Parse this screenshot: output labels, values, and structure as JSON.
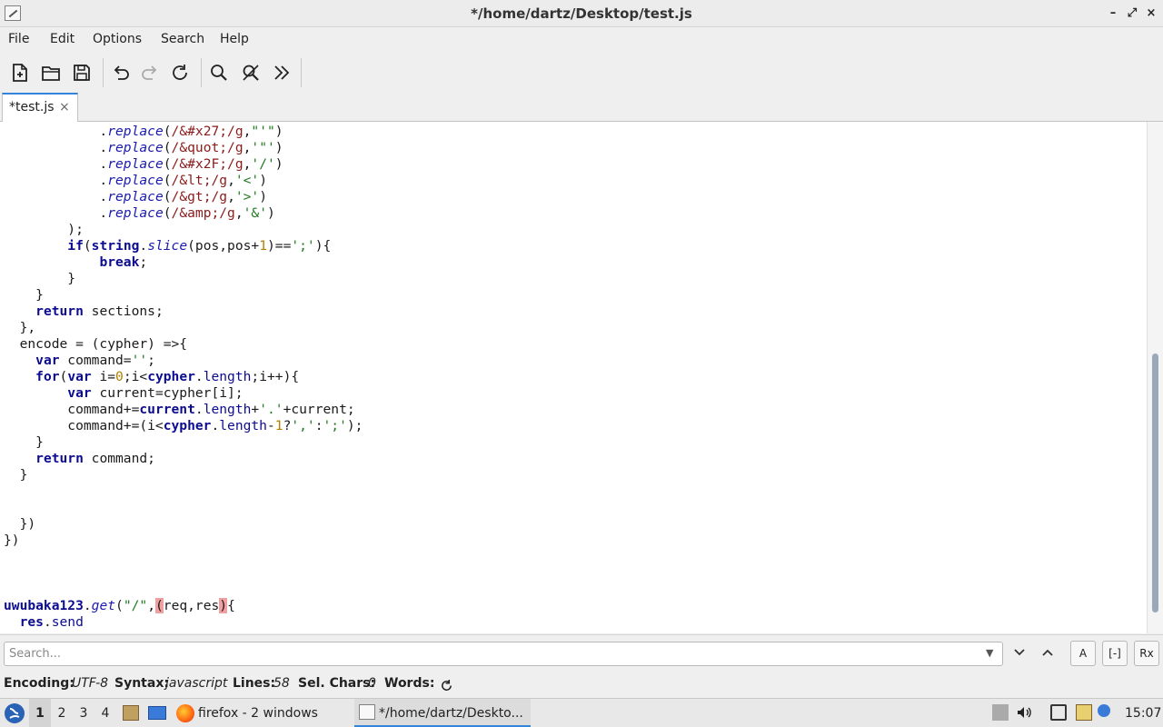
{
  "window": {
    "title": "*/home/dartz/Desktop/test.js"
  },
  "menu": [
    "File",
    "Edit",
    "Options",
    "Search",
    "Help"
  ],
  "tab": {
    "label": "*test.js",
    "close": "×"
  },
  "code_lines": [
    [
      [
        "            .",
        ""
      ],
      [
        "replace",
        "ki"
      ],
      [
        "(",
        ""
      ],
      [
        "/&#x27;/g",
        "rx"
      ],
      [
        ",",
        ""
      ],
      [
        "\"'\"",
        "st"
      ],
      [
        ")",
        ""
      ]
    ],
    [
      [
        "            .",
        ""
      ],
      [
        "replace",
        "ki"
      ],
      [
        "(",
        ""
      ],
      [
        "/&quot;/g",
        "rx"
      ],
      [
        ",",
        ""
      ],
      [
        "'\"'",
        "st"
      ],
      [
        ")",
        ""
      ]
    ],
    [
      [
        "            .",
        ""
      ],
      [
        "replace",
        "ki"
      ],
      [
        "(",
        ""
      ],
      [
        "/&#x2F;/g",
        "rx"
      ],
      [
        ",",
        ""
      ],
      [
        "'/'",
        "st"
      ],
      [
        ")",
        ""
      ]
    ],
    [
      [
        "            .",
        ""
      ],
      [
        "replace",
        "ki"
      ],
      [
        "(",
        ""
      ],
      [
        "/&lt;/g",
        "rx"
      ],
      [
        ",",
        ""
      ],
      [
        "'<'",
        "st"
      ],
      [
        ")",
        ""
      ]
    ],
    [
      [
        "            .",
        ""
      ],
      [
        "replace",
        "ki"
      ],
      [
        "(",
        ""
      ],
      [
        "/&gt;/g",
        "rx"
      ],
      [
        ",",
        ""
      ],
      [
        "'>'",
        "st"
      ],
      [
        ")",
        ""
      ]
    ],
    [
      [
        "            .",
        ""
      ],
      [
        "replace",
        "ki"
      ],
      [
        "(",
        ""
      ],
      [
        "/&amp;/g",
        "rx"
      ],
      [
        ",",
        ""
      ],
      [
        "'&'",
        "st"
      ],
      [
        ")",
        ""
      ]
    ],
    [
      [
        "        );",
        ""
      ]
    ],
    [
      [
        "        ",
        ""
      ],
      [
        "if",
        "kw"
      ],
      [
        "(",
        ""
      ],
      [
        "string",
        "kw"
      ],
      [
        ".",
        ""
      ],
      [
        "slice",
        "ki"
      ],
      [
        "(pos,pos+",
        ""
      ],
      [
        "1",
        "num"
      ],
      [
        ")==",
        ""
      ],
      [
        "';'",
        "st"
      ],
      [
        "){",
        ""
      ]
    ],
    [
      [
        "            ",
        ""
      ],
      [
        "break",
        "kw"
      ],
      [
        ";",
        ""
      ]
    ],
    [
      [
        "        }",
        ""
      ]
    ],
    [
      [
        "    }",
        ""
      ]
    ],
    [
      [
        "    ",
        ""
      ],
      [
        "return",
        "kw"
      ],
      [
        " sections;",
        ""
      ]
    ],
    [
      [
        "  },",
        ""
      ]
    ],
    [
      [
        "  encode = (cypher) =>{",
        ""
      ]
    ],
    [
      [
        "    ",
        ""
      ],
      [
        "var",
        "kw"
      ],
      [
        " command=",
        ""
      ],
      [
        "''",
        "st"
      ],
      [
        ";",
        ""
      ]
    ],
    [
      [
        "    ",
        ""
      ],
      [
        "for",
        "kw"
      ],
      [
        "(",
        ""
      ],
      [
        "var",
        "kw"
      ],
      [
        " i=",
        ""
      ],
      [
        "0",
        "num"
      ],
      [
        ";i<",
        ""
      ],
      [
        "cypher",
        "kw"
      ],
      [
        ".",
        ""
      ],
      [
        "length",
        "kn"
      ],
      [
        ";i++){",
        ""
      ]
    ],
    [
      [
        "        ",
        ""
      ],
      [
        "var",
        "kw"
      ],
      [
        " current=cypher[i];",
        ""
      ]
    ],
    [
      [
        "        command+=",
        ""
      ],
      [
        "current",
        "kw"
      ],
      [
        ".",
        ""
      ],
      [
        "length",
        "kn"
      ],
      [
        "+",
        ""
      ],
      [
        "'.'",
        "st"
      ],
      [
        "+current;",
        ""
      ]
    ],
    [
      [
        "        command+=(i<",
        ""
      ],
      [
        "cypher",
        "kw"
      ],
      [
        ".",
        ""
      ],
      [
        "length",
        "kn"
      ],
      [
        "-",
        ""
      ],
      [
        "1",
        "num"
      ],
      [
        "?",
        ""
      ],
      [
        "','",
        "st"
      ],
      [
        ":",
        ""
      ],
      [
        "';'",
        "st"
      ],
      [
        ");",
        ""
      ]
    ],
    [
      [
        "    }",
        ""
      ]
    ],
    [
      [
        "    ",
        ""
      ],
      [
        "return",
        "kw"
      ],
      [
        " command;",
        ""
      ]
    ],
    [
      [
        "  }",
        ""
      ]
    ],
    [
      [
        "",
        ""
      ]
    ],
    [
      [
        "",
        ""
      ]
    ],
    [
      [
        "  })",
        ""
      ]
    ],
    [
      [
        "})",
        ""
      ]
    ],
    [
      [
        "",
        ""
      ]
    ],
    [
      [
        "",
        ""
      ]
    ],
    [
      [
        "",
        ""
      ]
    ],
    [
      [
        "uwubaka123",
        "kw"
      ],
      [
        ".",
        ""
      ],
      [
        "get",
        "ki"
      ],
      [
        "(",
        ""
      ],
      [
        "\"/\"",
        "st"
      ],
      [
        ",",
        ""
      ],
      [
        "(",
        "hl"
      ],
      [
        "req,res",
        ""
      ],
      [
        ")",
        "hl"
      ],
      [
        "{",
        ""
      ]
    ],
    [
      [
        "  ",
        ""
      ],
      [
        "res",
        "kw"
      ],
      [
        ".",
        ""
      ],
      [
        "send",
        "kn"
      ]
    ]
  ],
  "search": {
    "placeholder": "Search...",
    "value": ""
  },
  "search_options": [
    "A",
    "[-]",
    "Rx"
  ],
  "status": {
    "encoding_label": "Encoding:",
    "encoding": "UTF-8",
    "syntax_label": "Syntax:",
    "syntax": "javascript",
    "lines_label": "Lines:",
    "lines": "58",
    "selchars_label": "Sel. Chars:",
    "selchars": "0",
    "words_label": "Words:"
  },
  "taskbar": {
    "workspaces": [
      "1",
      "2",
      "3",
      "4"
    ],
    "active_workspace": "1",
    "tasks": [
      "firefox - 2 windows",
      "*/home/dartz/Deskto..."
    ],
    "clock": "15:07"
  }
}
